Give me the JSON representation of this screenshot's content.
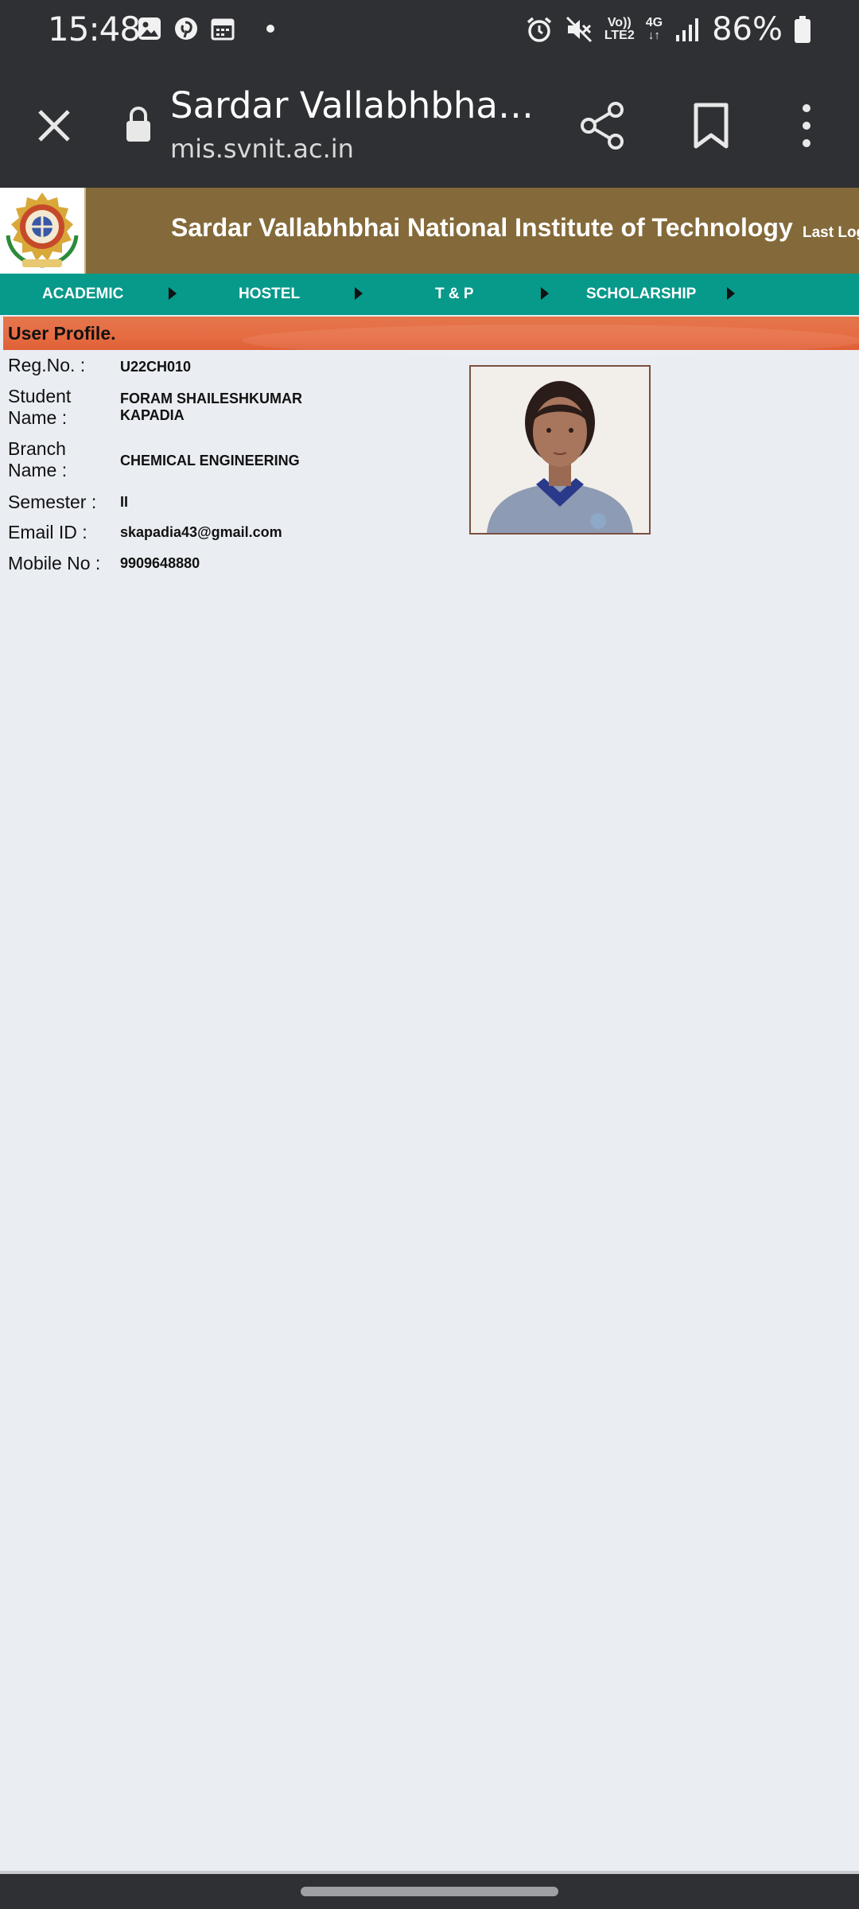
{
  "status_bar": {
    "time": "15:48",
    "left_icons": [
      "gallery-icon",
      "pinterest-icon",
      "calendar-icon",
      "dot-icon"
    ],
    "right_icons": [
      "alarm-icon",
      "mute-icon",
      "volte-icon",
      "4g-icon",
      "signal-icon",
      "battery-icon"
    ],
    "volte_label_top": "Vo))",
    "volte_label_bottom": "LTE2",
    "network_label": "4G",
    "battery": "86%"
  },
  "browser": {
    "page_title": "Sardar Vallabhbhai N…",
    "url": "mis.svnit.ac.in",
    "icons": [
      "close-icon",
      "lock-icon",
      "share-icon",
      "bookmark-icon",
      "more-menu-icon"
    ]
  },
  "site": {
    "title": "Sardar Vallabhbhai National Institute of Technology",
    "last_login_label": "Last Log",
    "colors": {
      "header": "#846a3a",
      "nav": "#07998a",
      "banner": "#e66c42"
    }
  },
  "nav": {
    "items": [
      {
        "label": "ACADEMIC"
      },
      {
        "label": "HOSTEL"
      },
      {
        "label": "T & P"
      },
      {
        "label": "SCHOLARSHIP"
      }
    ]
  },
  "profile": {
    "heading": "User Profile.",
    "fields": [
      {
        "label_line1": "Reg.No. :",
        "value_line1": "U22CH010"
      },
      {
        "label_line1": "Student",
        "label_line2": "Name :",
        "value_line1": "FORAM SHAILESHKUMAR",
        "value_line2": "KAPADIA"
      },
      {
        "label_line1": "Branch",
        "label_line2": "Name :",
        "value_line1": "CHEMICAL ENGINEERING"
      },
      {
        "label_line1": "Semester :",
        "value_line1": "II"
      },
      {
        "label_line1": "Email ID :",
        "value_line1": "skapadia43@gmail.com"
      },
      {
        "label_line1": "Mobile No :",
        "value_line1": "9909648880"
      }
    ]
  }
}
